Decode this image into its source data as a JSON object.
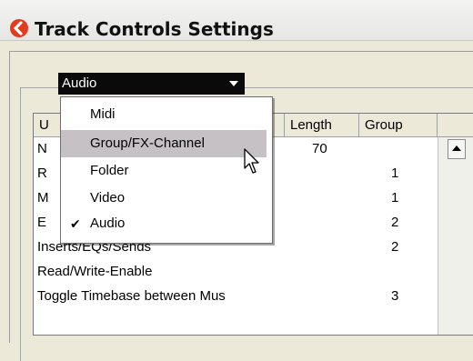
{
  "window": {
    "title": "Track Controls Settings"
  },
  "colors": {
    "hover": "#c6c1c4",
    "select_bg": "#0a0a0a",
    "icon_accent": "#e23b1e"
  },
  "preset": {
    "value": "Audio"
  },
  "table": {
    "headers": {
      "use": "U",
      "length": "Length",
      "group": "Group"
    },
    "rows": [
      {
        "name": "N",
        "length": "70",
        "group": ""
      },
      {
        "name": "R",
        "length": "",
        "group": "1"
      },
      {
        "name": "M",
        "length": "",
        "group": "1"
      },
      {
        "name": "E",
        "length": "",
        "group": "2"
      },
      {
        "name": "Inserts/EQs/Sends",
        "length": "",
        "group": "2"
      },
      {
        "name": "Read/Write-Enable",
        "length": "",
        "group": ""
      },
      {
        "name": "Toggle Timebase between Mus",
        "length": "",
        "group": "3"
      }
    ]
  },
  "menu": {
    "items": [
      {
        "label": "Midi",
        "checked": false,
        "hovered": false
      },
      {
        "label": "Group/FX-Channel",
        "checked": false,
        "hovered": true
      },
      {
        "label": "Folder",
        "checked": false,
        "hovered": false
      },
      {
        "label": "Video",
        "checked": false,
        "hovered": false
      },
      {
        "label": "Audio",
        "checked": true,
        "hovered": false
      }
    ]
  },
  "icons": {
    "app": "cubase-logo-icon",
    "cursor": "mouse-pointer-icon",
    "check": "checkmark-icon",
    "scroll_up": "scroll-up-arrow-icon"
  }
}
